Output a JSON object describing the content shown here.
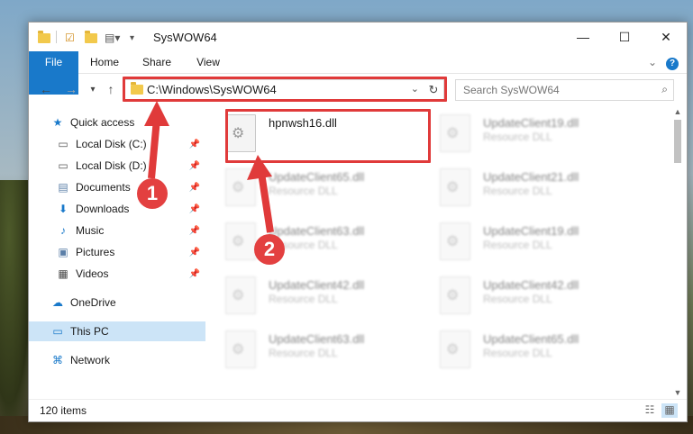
{
  "window": {
    "title": "SysWOW64",
    "minimize_label": "—",
    "maximize_label": "☐",
    "close_label": "✕"
  },
  "ribbon": {
    "file_label": "File",
    "home_label": "Home",
    "share_label": "Share",
    "view_label": "View",
    "help_icon": "?",
    "expand_icon": "⌄"
  },
  "address": {
    "path": "C:\\Windows\\SysWOW64",
    "search_placeholder": "Search SysWOW64",
    "refresh_icon": "↻",
    "search_icon": "⌕"
  },
  "sidebar": {
    "items": [
      {
        "label": "Quick access",
        "icon": "★"
      },
      {
        "label": "Local Disk (C:)",
        "icon": "▭"
      },
      {
        "label": "Local Disk (D:)",
        "icon": "▭"
      },
      {
        "label": "Documents",
        "icon": "▤"
      },
      {
        "label": "Downloads",
        "icon": "⬇"
      },
      {
        "label": "Music",
        "icon": "♪"
      },
      {
        "label": "Pictures",
        "icon": "▣"
      },
      {
        "label": "Videos",
        "icon": "▦"
      },
      {
        "label": "OneDrive",
        "icon": "☁"
      },
      {
        "label": "This PC",
        "icon": "▭"
      },
      {
        "label": "Network",
        "icon": "⌘"
      }
    ],
    "pin_icon": "📌"
  },
  "files": [
    {
      "name": "hpnwsh16.dll",
      "type": ""
    },
    {
      "name": "UpdateClient19.dll",
      "type": "Resource DLL"
    },
    {
      "name": "UpdateClient65.dll",
      "type": "Resource DLL"
    },
    {
      "name": "UpdateClient21.dll",
      "type": "Resource DLL"
    },
    {
      "name": "UpdateClient63.dll",
      "type": "Resource DLL"
    },
    {
      "name": "UpdateClient19.dll",
      "type": "Resource DLL"
    },
    {
      "name": "UpdateClient42.dll",
      "type": "Resource DLL"
    },
    {
      "name": "UpdateClient42.dll",
      "type": "Resource DLL"
    },
    {
      "name": "UpdateClient63.dll",
      "type": "Resource DLL"
    },
    {
      "name": "UpdateClient65.dll",
      "type": "Resource DLL"
    }
  ],
  "status": {
    "item_count": "120 items"
  },
  "annotations": {
    "marker_1": "1",
    "marker_2": "2",
    "accent_color": "#e03a3a"
  }
}
